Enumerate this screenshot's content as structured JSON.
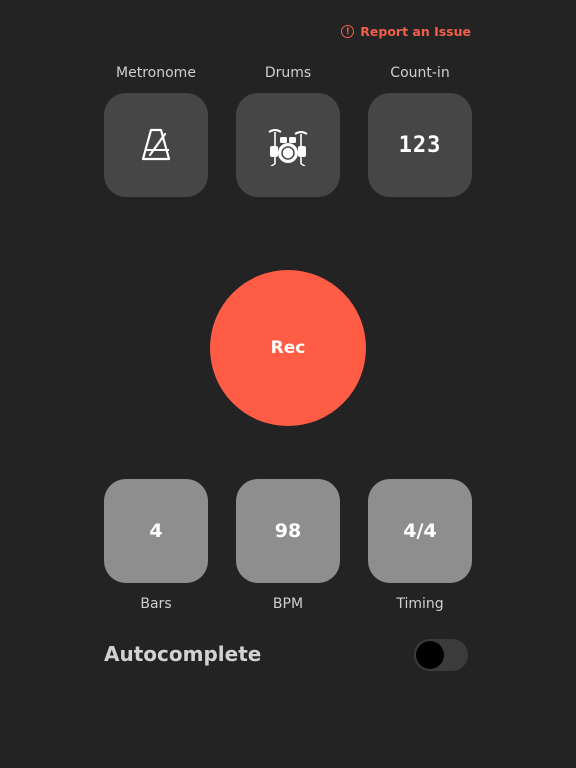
{
  "header": {
    "report_icon": "warning-circle-icon",
    "report_label": "Report an Issue"
  },
  "options": {
    "metronome": {
      "label": "Metronome",
      "icon": "metronome-icon"
    },
    "drums": {
      "label": "Drums",
      "icon": "drum-kit-icon"
    },
    "count_in": {
      "label": "Count-in",
      "value": "123"
    }
  },
  "record": {
    "label": "Rec"
  },
  "settings": {
    "bars": {
      "label": "Bars",
      "value": "4"
    },
    "bpm": {
      "label": "BPM",
      "value": "98"
    },
    "timing": {
      "label": "Timing",
      "value": "4/4"
    }
  },
  "autocomplete": {
    "label": "Autocomplete",
    "enabled": false
  },
  "colors": {
    "background": "#232323",
    "accent": "#ff5c45",
    "tile_dark": "#464646",
    "tile_light": "#8e8e8e"
  }
}
